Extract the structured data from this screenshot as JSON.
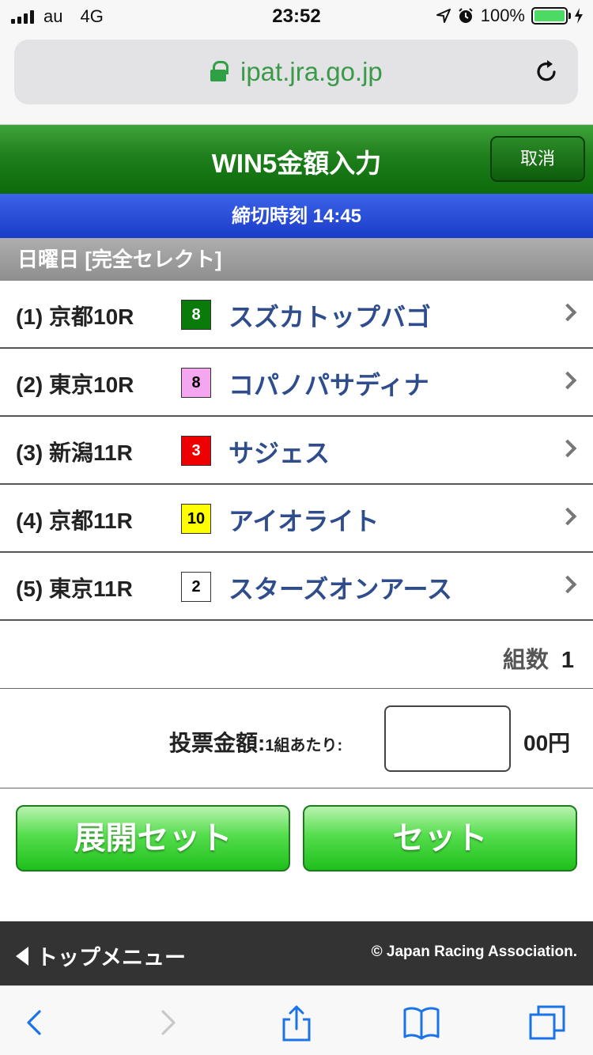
{
  "status_bar": {
    "carrier": "au",
    "network": "4G",
    "time": "23:52",
    "battery": "100%",
    "battery_color": "#4cd964"
  },
  "browser": {
    "url": "ipat.jra.go.jp",
    "lock_icon": "lock-icon",
    "reload_icon": "reload-icon"
  },
  "header": {
    "title": "WIN5金額入力",
    "cancel_label": "取消",
    "deadline": "締切時刻 14:45"
  },
  "section": {
    "title": "日曜日 [完全セレクト]"
  },
  "races": [
    {
      "label": "(1) 京都10R",
      "number": "8",
      "number_bg": "#0a7a0a",
      "number_fg": "#ffffff",
      "horse": "スズカトップバゴ"
    },
    {
      "label": "(2) 東京10R",
      "number": "8",
      "number_bg": "#f4a6f0",
      "number_fg": "#000000",
      "horse": "コパノパサディナ"
    },
    {
      "label": "(3) 新潟11R",
      "number": "3",
      "number_bg": "#ee0000",
      "number_fg": "#ffffff",
      "horse": "サジェス"
    },
    {
      "label": "(4) 京都11R",
      "number": "10",
      "number_bg": "#ffff00",
      "number_fg": "#000000",
      "horse": "アイオライト"
    },
    {
      "label": "(5) 東京11R",
      "number": "2",
      "number_bg": "#ffffff",
      "number_fg": "#000000",
      "horse": "スターズオンアース"
    }
  ],
  "combo": {
    "label": "組数",
    "value": "1"
  },
  "amount": {
    "label": "投票金額:",
    "sublabel": "1組あたり:",
    "value": "",
    "unit": "00円"
  },
  "buttons": {
    "expand_set": "展開セット",
    "set": "セット"
  },
  "footer": {
    "top_menu": "トップメニュー",
    "copyright": "© Japan Racing Association."
  },
  "toolbar": {
    "icons": [
      "back-icon",
      "forward-icon",
      "share-icon",
      "bookmarks-icon",
      "tabs-icon"
    ]
  }
}
